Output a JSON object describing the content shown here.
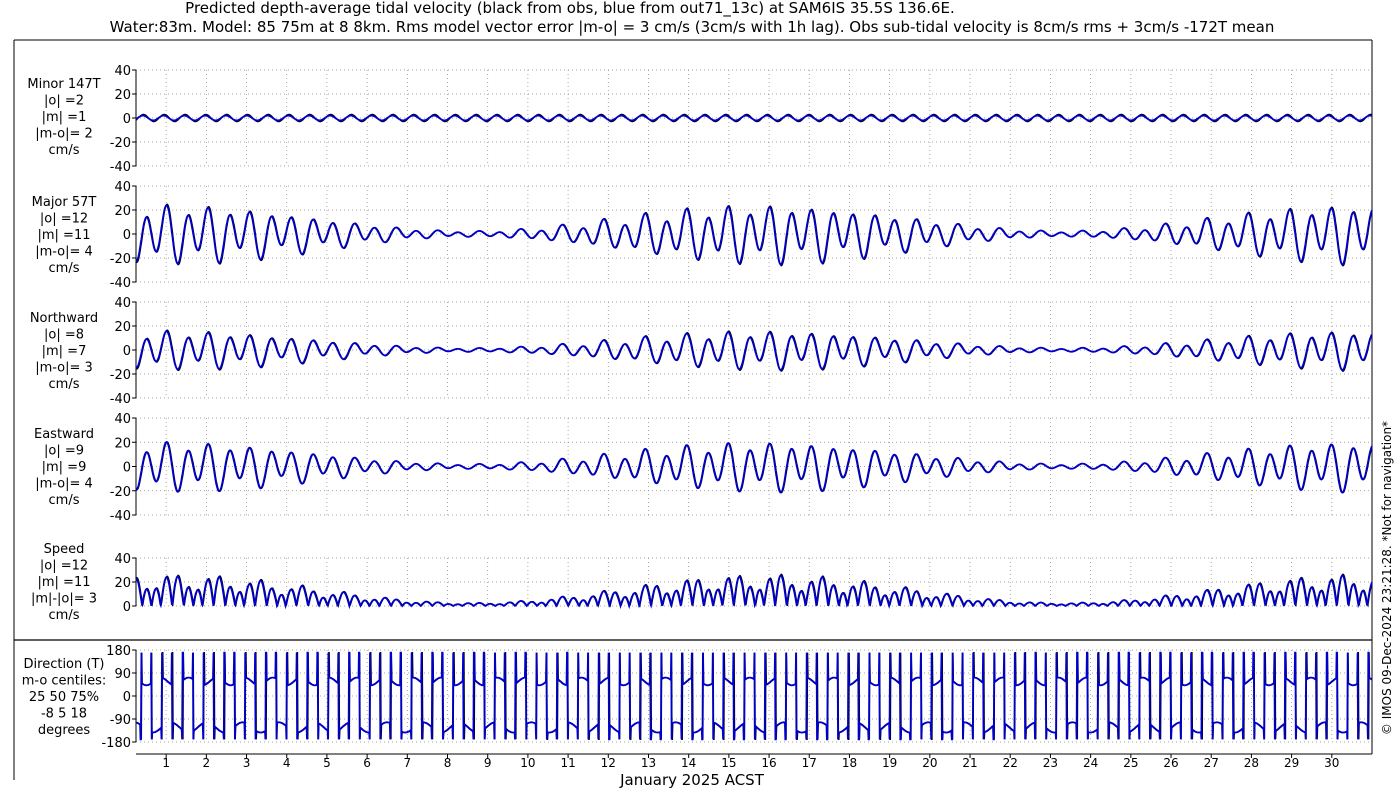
{
  "header": {
    "title_line1": "Predicted depth-average tidal velocity (black from obs, blue from out71_13c) at SAM6IS 35.5S 136.6E.",
    "title_line2": "Water:83m. Model: 85 75m at 8 8km. Rms model vector error |m-o| = 3 cm/s (3cm/s with 1h lag). Obs sub-tidal velocity is 8cm/s rms + 3cm/s -172T mean"
  },
  "credit": "© IMOS 09-Dec-2024 23:21:28. *Not for navigation*",
  "colors": {
    "obs": "#000000",
    "model": "#0000cc",
    "grid": "#888888"
  },
  "chart_data": {
    "type": "line",
    "xlabel": "January 2025 ACST",
    "x_ticks": [
      "1",
      "2",
      "3",
      "4",
      "5",
      "6",
      "7",
      "8",
      "9",
      "10",
      "11",
      "12",
      "13",
      "14",
      "15",
      "16",
      "17",
      "18",
      "19",
      "20",
      "21",
      "22",
      "23",
      "24",
      "25",
      "26",
      "27",
      "28",
      "29",
      "30"
    ],
    "xlim": [
      0.25,
      31.0
    ],
    "series_names": [
      "obs",
      "out71_13c"
    ],
    "panels": [
      {
        "id": "minor",
        "label_lines": [
          "Minor 147T",
          "|o| =2",
          "|m| =1",
          "|m-o|= 2",
          "cm/s"
        ],
        "yticks": [
          "40",
          "20",
          "0",
          "-20",
          "-40"
        ],
        "ylim": [
          -40,
          40
        ],
        "series": [
          {
            "name": "obs",
            "amplitude": 3,
            "mean": 0
          },
          {
            "name": "out71_13c",
            "amplitude": 2,
            "mean": 0
          }
        ]
      },
      {
        "id": "major",
        "label_lines": [
          "Major 57T",
          "|o| =12",
          "|m| =11",
          "|m-o|= 4",
          "cm/s"
        ],
        "yticks": [
          "40",
          "20",
          "0",
          "-20",
          "-40"
        ],
        "ylim": [
          -40,
          40
        ],
        "series": [
          {
            "name": "obs",
            "amplitude": 27,
            "mean": 0
          },
          {
            "name": "out71_13c",
            "amplitude": 26,
            "mean": 0
          }
        ]
      },
      {
        "id": "northward",
        "label_lines": [
          "Northward",
          "|o| =8",
          "|m| =7",
          "|m-o|= 3",
          "cm/s"
        ],
        "yticks": [
          "40",
          "20",
          "0",
          "-20",
          "-40"
        ],
        "ylim": [
          -40,
          40
        ],
        "series": [
          {
            "name": "obs",
            "amplitude": 18,
            "mean": 0
          },
          {
            "name": "out71_13c",
            "amplitude": 17,
            "mean": 0
          }
        ]
      },
      {
        "id": "eastward",
        "label_lines": [
          "Eastward",
          "|o| =9",
          "|m| =9",
          "|m-o|= 4",
          "cm/s"
        ],
        "yticks": [
          "40",
          "20",
          "0",
          "-20",
          "-40"
        ],
        "ylim": [
          -40,
          40
        ],
        "series": [
          {
            "name": "obs",
            "amplitude": 22,
            "mean": 0
          },
          {
            "name": "out71_13c",
            "amplitude": 22,
            "mean": 0
          }
        ]
      },
      {
        "id": "speed",
        "label_lines": [
          "Speed",
          "|o| =12",
          "|m| =11",
          "|m|-|o|= 3",
          "cm/s"
        ],
        "yticks": [
          "40",
          "20",
          "0"
        ],
        "ylim": [
          0,
          40
        ],
        "series": [
          {
            "name": "obs",
            "amplitude": 27,
            "mean": 0
          },
          {
            "name": "out71_13c",
            "amplitude": 26,
            "mean": 0
          }
        ]
      },
      {
        "id": "direction",
        "label_lines": [
          "Direction (T)",
          "m-o centiles:",
          "25  50  75%",
          "-8   5  18",
          "degrees"
        ],
        "yticks": [
          "180",
          "90",
          "0",
          "-90",
          "-180"
        ],
        "ylim": [
          -180,
          180
        ],
        "series": [
          {
            "name": "obs",
            "levels": [
              57,
              -123
            ]
          },
          {
            "name": "out71_13c",
            "levels": [
              57,
              -123
            ]
          }
        ]
      }
    ]
  }
}
